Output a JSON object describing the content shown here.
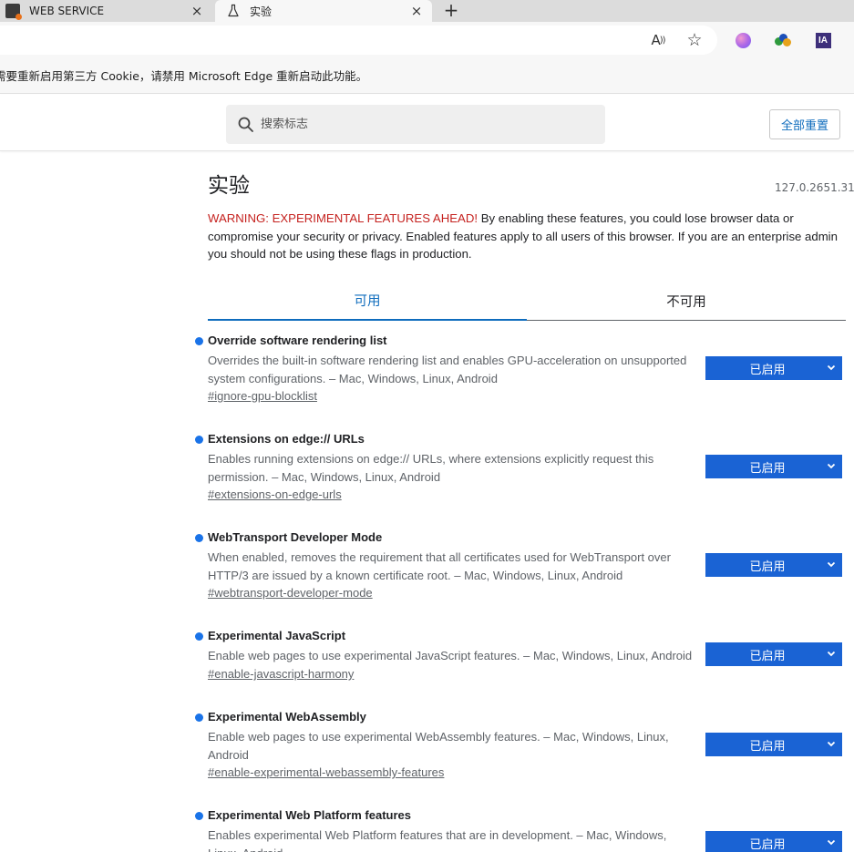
{
  "browser": {
    "tabs": [
      {
        "title": "WEB SERVICE",
        "close": "×"
      },
      {
        "title": "实验",
        "close": "×"
      }
    ],
    "new_tab": "+",
    "toolbar": {
      "read_aloud": "A",
      "favorite": "☆",
      "extension_ia": "IA"
    }
  },
  "infobar": {
    "text": "需要重新启用第三方 Cookie，请禁用 Microsoft Edge 重新启动此功能。"
  },
  "header": {
    "search_placeholder": "搜索标志",
    "reset_label": "全部重置"
  },
  "page": {
    "title": "实验",
    "version": "127.0.2651.31",
    "warning_prefix": "WARNING: EXPERIMENTAL FEATURES AHEAD!",
    "warning_body": " By enabling these features, you could lose browser data or compromise your security or privacy. Enabled features apply to all users of this browser. If you are an enterprise admin you should not be using these flags in production.",
    "tabs": [
      {
        "label": "可用"
      },
      {
        "label": "不可用"
      }
    ]
  },
  "flags": [
    {
      "name": "Override software rendering list",
      "description": "Overrides the built-in software rendering list and enables GPU-acceleration on unsupported system configurations. – Mac, Windows, Linux, Android",
      "link": "#ignore-gpu-blocklist",
      "state": "已启用"
    },
    {
      "name": "Extensions on edge:// URLs",
      "description": "Enables running extensions on edge:// URLs, where extensions explicitly request this permission. – Mac, Windows, Linux, Android",
      "link": "#extensions-on-edge-urls",
      "state": "已启用"
    },
    {
      "name": "WebTransport Developer Mode",
      "description": "When enabled, removes the requirement that all certificates used for WebTransport over HTTP/3 are issued by a known certificate root. – Mac, Windows, Linux, Android",
      "link": "#webtransport-developer-mode",
      "state": "已启用"
    },
    {
      "name": "Experimental JavaScript",
      "description": "Enable web pages to use experimental JavaScript features. – Mac, Windows, Linux, Android",
      "link": "#enable-javascript-harmony",
      "state": "已启用"
    },
    {
      "name": "Experimental WebAssembly",
      "description": "Enable web pages to use experimental WebAssembly features. – Mac, Windows, Linux, Android",
      "link": "#enable-experimental-webassembly-features",
      "state": "已启用"
    },
    {
      "name": "Experimental Web Platform features",
      "description": "Enables experimental Web Platform features that are in development. – Mac, Windows, Linux, Android",
      "link": "",
      "state": "已启用"
    }
  ],
  "colors": {
    "accent": "#0f6cbd",
    "flag_dot": "#1a73e8",
    "select_bg": "#1a63d4",
    "warning_red": "#c5221f"
  }
}
